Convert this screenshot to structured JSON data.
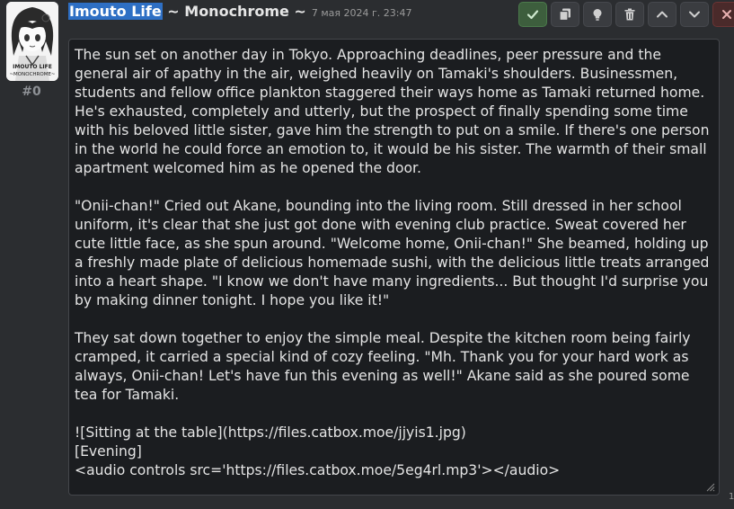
{
  "message": {
    "index": "#0",
    "character_name": "Imouto Life",
    "chat_suffix": " ~ Monochrome ~",
    "timestamp": "7 мая 2024 г. 23:47",
    "avatar_text_1": "IMOUTO LIFE",
    "avatar_text_2": "~MONOCHROME~",
    "edit_text": "The sun set on another day in Tokyo. Approaching deadlines, peer pressure and the general air of apathy in the air, weighed heavily on Tamaki's shoulders. Businessmen, students and fellow office plankton staggered their ways home as Tamaki returned home. He's exhausted, completely and utterly, but the prospect of finally spending some time with his beloved little sister, gave him the strength to put on a smile. If there's one person in the world he could force an emotion to, it would be his sister. The warmth of their small apartment welcomed him as he opened the door.\n\n\"Onii-chan!\" Cried out Akane, bounding into the living room. Still dressed in her school uniform, it's clear that she just got done with evening club practice. Sweat covered her cute little face, as she spun around. \"Welcome home, Onii-chan!\" She beamed, holding up a freshly made plate of delicious homemade sushi, with the delicious little treats arranged into a heart shape. \"I know we don't have many ingredients... But thought I'd surprise you by making dinner tonight. I hope you like it!\"\n\nThey sat down together to enjoy the simple meal. Despite the kitchen room being fairly cramped, it carried a special kind of cozy feeling. \"Mh. Thank you for your hard work as always, Onii-chan! Let's have fun this evening as well!\" Akane said as she poured some tea for Tamaki.\n\n![Sitting at the table](https://files.catbox.moe/jjyis1.jpg)\n[Evening]\n<audio controls src='https://files.catbox.moe/5eg4rl.mp3'></audio>"
  },
  "edge_mark": "1",
  "icons": {
    "confirm": "check-icon",
    "copy": "copy-icon",
    "hint": "lightbulb-icon",
    "delete": "trash-icon",
    "move_up": "chevron-up-icon",
    "move_down": "chevron-down-icon",
    "cancel": "close-icon"
  },
  "colors": {
    "background": "#2b2d30",
    "editor_background": "#1b1d20",
    "selection": "#2e6fc4",
    "confirm": "#3d5e3d",
    "cancel": "#4a2a2a"
  }
}
